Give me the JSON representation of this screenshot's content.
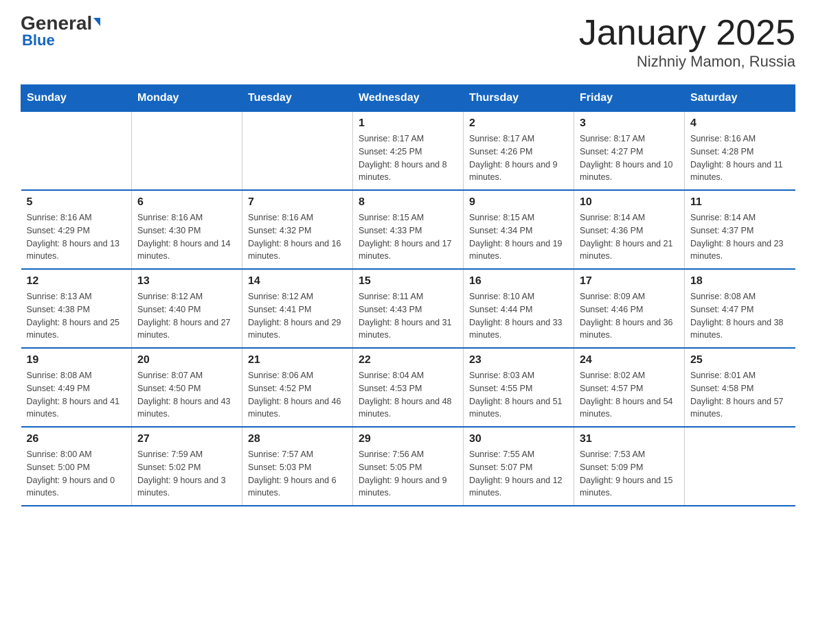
{
  "header": {
    "logo_general": "General",
    "logo_blue": "Blue",
    "title": "January 2025",
    "subtitle": "Nizhniy Mamon, Russia"
  },
  "weekdays": [
    "Sunday",
    "Monday",
    "Tuesday",
    "Wednesday",
    "Thursday",
    "Friday",
    "Saturday"
  ],
  "weeks": [
    [
      {
        "day": "",
        "info": ""
      },
      {
        "day": "",
        "info": ""
      },
      {
        "day": "",
        "info": ""
      },
      {
        "day": "1",
        "info": "Sunrise: 8:17 AM\nSunset: 4:25 PM\nDaylight: 8 hours and 8 minutes."
      },
      {
        "day": "2",
        "info": "Sunrise: 8:17 AM\nSunset: 4:26 PM\nDaylight: 8 hours and 9 minutes."
      },
      {
        "day": "3",
        "info": "Sunrise: 8:17 AM\nSunset: 4:27 PM\nDaylight: 8 hours and 10 minutes."
      },
      {
        "day": "4",
        "info": "Sunrise: 8:16 AM\nSunset: 4:28 PM\nDaylight: 8 hours and 11 minutes."
      }
    ],
    [
      {
        "day": "5",
        "info": "Sunrise: 8:16 AM\nSunset: 4:29 PM\nDaylight: 8 hours and 13 minutes."
      },
      {
        "day": "6",
        "info": "Sunrise: 8:16 AM\nSunset: 4:30 PM\nDaylight: 8 hours and 14 minutes."
      },
      {
        "day": "7",
        "info": "Sunrise: 8:16 AM\nSunset: 4:32 PM\nDaylight: 8 hours and 16 minutes."
      },
      {
        "day": "8",
        "info": "Sunrise: 8:15 AM\nSunset: 4:33 PM\nDaylight: 8 hours and 17 minutes."
      },
      {
        "day": "9",
        "info": "Sunrise: 8:15 AM\nSunset: 4:34 PM\nDaylight: 8 hours and 19 minutes."
      },
      {
        "day": "10",
        "info": "Sunrise: 8:14 AM\nSunset: 4:36 PM\nDaylight: 8 hours and 21 minutes."
      },
      {
        "day": "11",
        "info": "Sunrise: 8:14 AM\nSunset: 4:37 PM\nDaylight: 8 hours and 23 minutes."
      }
    ],
    [
      {
        "day": "12",
        "info": "Sunrise: 8:13 AM\nSunset: 4:38 PM\nDaylight: 8 hours and 25 minutes."
      },
      {
        "day": "13",
        "info": "Sunrise: 8:12 AM\nSunset: 4:40 PM\nDaylight: 8 hours and 27 minutes."
      },
      {
        "day": "14",
        "info": "Sunrise: 8:12 AM\nSunset: 4:41 PM\nDaylight: 8 hours and 29 minutes."
      },
      {
        "day": "15",
        "info": "Sunrise: 8:11 AM\nSunset: 4:43 PM\nDaylight: 8 hours and 31 minutes."
      },
      {
        "day": "16",
        "info": "Sunrise: 8:10 AM\nSunset: 4:44 PM\nDaylight: 8 hours and 33 minutes."
      },
      {
        "day": "17",
        "info": "Sunrise: 8:09 AM\nSunset: 4:46 PM\nDaylight: 8 hours and 36 minutes."
      },
      {
        "day": "18",
        "info": "Sunrise: 8:08 AM\nSunset: 4:47 PM\nDaylight: 8 hours and 38 minutes."
      }
    ],
    [
      {
        "day": "19",
        "info": "Sunrise: 8:08 AM\nSunset: 4:49 PM\nDaylight: 8 hours and 41 minutes."
      },
      {
        "day": "20",
        "info": "Sunrise: 8:07 AM\nSunset: 4:50 PM\nDaylight: 8 hours and 43 minutes."
      },
      {
        "day": "21",
        "info": "Sunrise: 8:06 AM\nSunset: 4:52 PM\nDaylight: 8 hours and 46 minutes."
      },
      {
        "day": "22",
        "info": "Sunrise: 8:04 AM\nSunset: 4:53 PM\nDaylight: 8 hours and 48 minutes."
      },
      {
        "day": "23",
        "info": "Sunrise: 8:03 AM\nSunset: 4:55 PM\nDaylight: 8 hours and 51 minutes."
      },
      {
        "day": "24",
        "info": "Sunrise: 8:02 AM\nSunset: 4:57 PM\nDaylight: 8 hours and 54 minutes."
      },
      {
        "day": "25",
        "info": "Sunrise: 8:01 AM\nSunset: 4:58 PM\nDaylight: 8 hours and 57 minutes."
      }
    ],
    [
      {
        "day": "26",
        "info": "Sunrise: 8:00 AM\nSunset: 5:00 PM\nDaylight: 9 hours and 0 minutes."
      },
      {
        "day": "27",
        "info": "Sunrise: 7:59 AM\nSunset: 5:02 PM\nDaylight: 9 hours and 3 minutes."
      },
      {
        "day": "28",
        "info": "Sunrise: 7:57 AM\nSunset: 5:03 PM\nDaylight: 9 hours and 6 minutes."
      },
      {
        "day": "29",
        "info": "Sunrise: 7:56 AM\nSunset: 5:05 PM\nDaylight: 9 hours and 9 minutes."
      },
      {
        "day": "30",
        "info": "Sunrise: 7:55 AM\nSunset: 5:07 PM\nDaylight: 9 hours and 12 minutes."
      },
      {
        "day": "31",
        "info": "Sunrise: 7:53 AM\nSunset: 5:09 PM\nDaylight: 9 hours and 15 minutes."
      },
      {
        "day": "",
        "info": ""
      }
    ]
  ]
}
